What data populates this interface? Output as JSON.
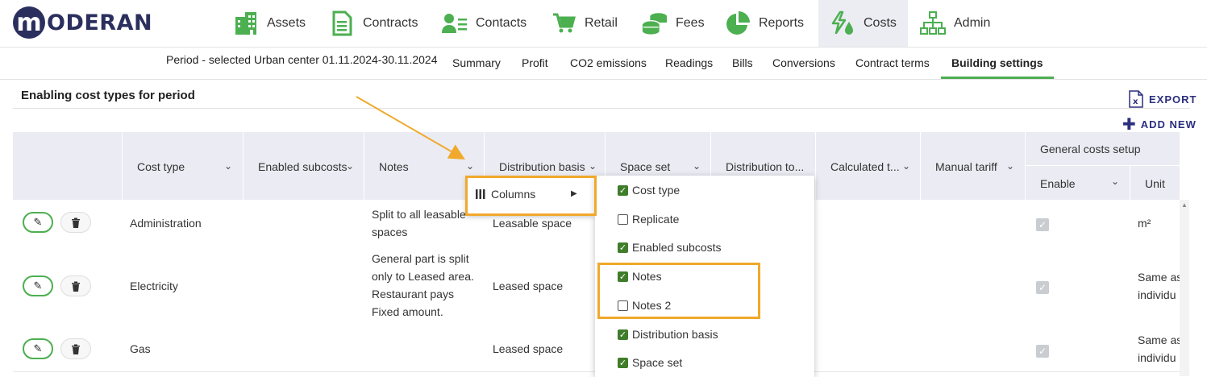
{
  "brand": {
    "logo_letter": "m",
    "logo_text": "ODERAN"
  },
  "nav": [
    {
      "label": "Assets",
      "icon": "building-icon"
    },
    {
      "label": "Contracts",
      "icon": "document-icon"
    },
    {
      "label": "Contacts",
      "icon": "contacts-icon"
    },
    {
      "label": "Retail",
      "icon": "cart-icon"
    },
    {
      "label": "Fees",
      "icon": "coins-icon"
    },
    {
      "label": "Reports",
      "icon": "pie-chart-icon"
    },
    {
      "label": "Costs",
      "icon": "utilities-icon",
      "active": true
    },
    {
      "label": "Admin",
      "icon": "org-chart-icon"
    }
  ],
  "subnav": {
    "period": "Period - selected Urban center 01.11.2024-30.11.2024",
    "items": [
      "Summary",
      "Profit",
      "CO2 emissions",
      "Readings",
      "Bills",
      "Conversions",
      "Contract terms",
      "Building settings"
    ],
    "active": "Building settings"
  },
  "section": {
    "title": "Enabling cost types for period",
    "export_label": "EXPORT",
    "add_new_label": "ADD NEW"
  },
  "table": {
    "columns": [
      "Cost type",
      "Enabled subcosts",
      "Notes",
      "Distribution basis",
      "Space set",
      "Distribution to...",
      "Calculated t...",
      "Manual tariff"
    ],
    "group_header": "General costs setup",
    "group_columns": [
      "Enable",
      "Unit"
    ],
    "rows": [
      {
        "cost_type": "Administration",
        "notes": [
          "Split to all leasable",
          "spaces"
        ],
        "distribution_basis": "Leasable space",
        "unit": [
          "m²"
        ]
      },
      {
        "cost_type": "Electricity",
        "notes": [
          "General part is split",
          "only to Leased area.",
          "Restaurant pays",
          "Fixed amount."
        ],
        "distribution_basis": "Leased space",
        "unit": [
          "Same as",
          "individu"
        ]
      },
      {
        "cost_type": "Gas",
        "notes": [],
        "distribution_basis": "Leased space",
        "unit": [
          "Same as",
          "individu"
        ]
      }
    ]
  },
  "context_menu": {
    "label": "Columns"
  },
  "column_options": [
    {
      "label": "Cost type",
      "checked": true
    },
    {
      "label": "Replicate",
      "checked": false
    },
    {
      "label": "Enabled subcosts",
      "checked": true
    },
    {
      "label": "Notes",
      "checked": true
    },
    {
      "label": "Notes 2",
      "checked": false
    },
    {
      "label": "Distribution basis",
      "checked": true
    },
    {
      "label": "Space set",
      "checked": true
    }
  ],
  "colors": {
    "accent_green": "#4caf50",
    "brand_navy": "#2b2f5e",
    "highlight": "#f0a92b",
    "header_bg": "#ebebf3"
  }
}
